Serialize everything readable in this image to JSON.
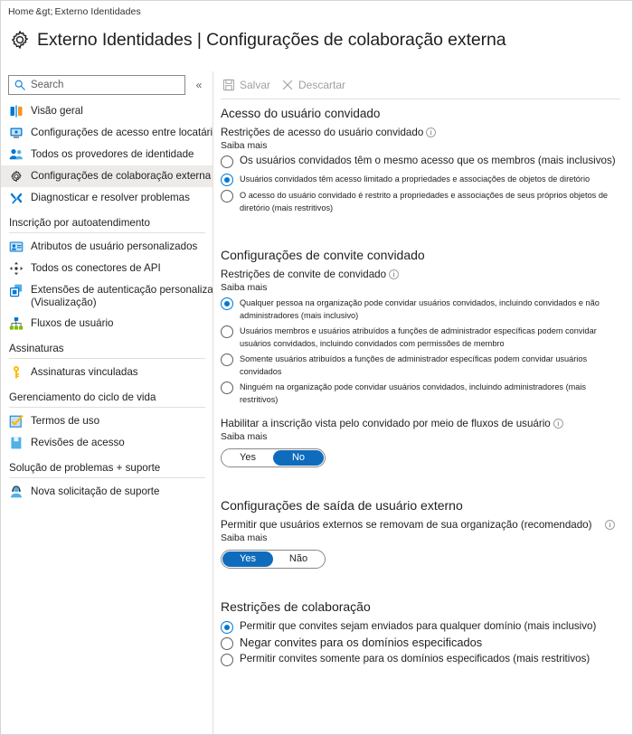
{
  "breadcrumb": {
    "home": "Home",
    "separator": "&gt;",
    "item1": "Externo",
    "item2": "Identidades"
  },
  "header": {
    "title": "Externo  Identidades | Configurações de colaboração externa",
    "gear_icon": "gear-icon"
  },
  "sidebar": {
    "search": {
      "placeholder": "Search",
      "value": "",
      "icon": "search-icon"
    },
    "collapse": {
      "label": "«",
      "icon": "chevron-double-left-icon"
    },
    "items": [
      {
        "label": "Visão geral",
        "icon": "overview-icon",
        "selected": false
      },
      {
        "label": "Configurações de acesso entre locatários",
        "icon": "monitor-icon",
        "selected": false
      },
      {
        "label": "Todos os provedores de identidade",
        "icon": "people-icon",
        "selected": false
      },
      {
        "label": "Configurações de colaboração externa",
        "icon": "gear-icon",
        "selected": true
      },
      {
        "label": "Diagnosticar e resolver problemas",
        "icon": "wrench-icon",
        "selected": false
      }
    ],
    "group1": {
      "title": "Inscrição por autoatendimento"
    },
    "items2": [
      {
        "label": "Atributos de usuário personalizados",
        "icon": "id-card-icon"
      },
      {
        "label": "Todos os conectores de API",
        "icon": "connector-icon"
      },
      {
        "label": "Extensões de autenticação personalizadas",
        "sub": "(Visualização)",
        "icon": "extension-icon"
      },
      {
        "label": "Fluxos de usuário",
        "icon": "flow-icon"
      }
    ],
    "group2": {
      "title": "Assinaturas"
    },
    "items3": [
      {
        "label": "Assinaturas vinculadas",
        "icon": "key-icon"
      }
    ],
    "group3": {
      "title": "Gerenciamento do ciclo de vida"
    },
    "items4": [
      {
        "label": "Termos de uso",
        "icon": "checkbox-icon"
      },
      {
        "label": "Revisões de acesso",
        "icon": "book-icon"
      }
    ],
    "group4": {
      "title": "Solução de problemas + suporte"
    },
    "items5": [
      {
        "label": "Nova solicitação de suporte",
        "icon": "support-person-icon"
      }
    ]
  },
  "commandbar": {
    "save": {
      "label": "Salvar",
      "icon": "save-icon"
    },
    "discard": {
      "label": "Descartar",
      "icon": "discard-x-icon"
    }
  },
  "main": {
    "section1": {
      "title": "Acesso do usuário convidado",
      "sub_label": "Restrições de acesso do usuário convidado",
      "info_icon": "info-icon",
      "learn_more": "Saiba mais",
      "options": [
        {
          "label": "Os usuários convidados têm o mesmo acesso que os membros (mais inclusivos)",
          "selected": false,
          "size": "normal"
        },
        {
          "label": "Usuários convidados têm acesso limitado a propriedades e associações de objetos de diretório",
          "selected": true,
          "size": "small"
        },
        {
          "label": "O acesso do usuário convidado é restrito a propriedades e associações de seus próprios objetos de diretório (mais restritivos)",
          "selected": false,
          "size": "small"
        }
      ]
    },
    "section2": {
      "title": "Configurações de convite convidado",
      "sub_label": "Restrições de convite de convidado",
      "info_icon": "info-icon",
      "learn_more": "Saiba mais",
      "options": [
        {
          "label": "Qualquer pessoa na organização pode convidar usuários convidados, incluindo convidados e não administradores (mais inclusivo)",
          "selected": true,
          "size": "small"
        },
        {
          "label": "Usuários membros e usuários atribuídos a funções de administrador específicas podem convidar usuários convidados, incluindo convidados com permissões de membro",
          "selected": false,
          "size": "small"
        },
        {
          "label": "Somente usuários atribuídos a funções de administrador específicas podem convidar usuários convidados",
          "selected": false,
          "size": "small"
        },
        {
          "label": "Ninguém na organização pode convidar usuários convidados, incluindo administradores (mais restritivos)",
          "selected": false,
          "size": "small"
        }
      ]
    },
    "section3": {
      "sub_label": "Habilitar a inscrição vista pelo convidado por meio de fluxos de usuário",
      "info_icon": "info-icon",
      "learn_more": "Saiba mais",
      "toggle": {
        "yes": "Yes",
        "no": "No",
        "value": "No"
      }
    },
    "section4": {
      "title": "Configurações de saída de usuário externo",
      "sub_label": "Permitir que usuários externos se removam de sua organização (recomendado)",
      "info_icon": "info-icon",
      "learn_more": "Saiba mais",
      "toggle": {
        "yes": "Yes",
        "no": "Não",
        "value": "Yes"
      }
    },
    "section5": {
      "title": "Restrições de colaboração",
      "options": [
        {
          "label": "Permitir que convites sejam enviados para qualquer domínio (mais inclusivo)",
          "selected": true
        },
        {
          "label": "Negar convites para os domínios especificados",
          "selected": false
        },
        {
          "label": "Permitir convites somente para os domínios especificados (mais restritivos)",
          "selected": false
        }
      ]
    }
  },
  "colors": {
    "accent": "#0078d4",
    "toggle_on": "#0f6cbd",
    "selected_bg": "#edebe9",
    "text": "#201f1e"
  }
}
